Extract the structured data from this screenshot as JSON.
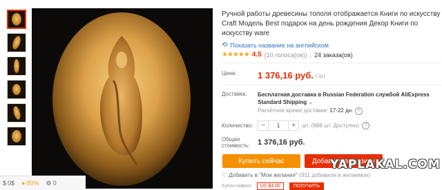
{
  "thumbnails": [
    "thumb-1",
    "thumb-2",
    "thumb-3",
    "thumb-4",
    "thumb-5",
    "thumb-6"
  ],
  "product": {
    "title": "Ручной работы древесины тополя отображается Книги по искусству Craft Модель Best подарок на день рождения Декор Книги по искусству ware",
    "translate_link": "Показать название на английском",
    "rating_value": "4.5",
    "votes": "(10 голоса(ов))",
    "orders": "24 заказа(ов)"
  },
  "price": {
    "label": "Цена:",
    "value": "1 376,16 руб.",
    "unit": "/ шт."
  },
  "shipping": {
    "label": "Доставка:",
    "main": "Бесплатная доставка в Russian Federation службой AliExpress Standard Shipping",
    "time_label": "Расчётное время доставки:",
    "time_value": "17-22 дн."
  },
  "quantity": {
    "label": "Количество:",
    "value": "1",
    "note": "шт. (988 шт. Доступно)",
    "minus": "−",
    "plus": "+"
  },
  "total": {
    "label_line1": "Общая",
    "label_line2": "стоимость:",
    "value": "1 376,16 руб."
  },
  "actions": {
    "buy_now": "Купить сейчас",
    "add_to_cart": "Добавить в корзину",
    "wishlist": "Добавить в \"Мои желания\"",
    "wishlist_count": "(911 добавили в желаемое)"
  },
  "coupon": {
    "label": "Купон нового",
    "badge": "US $4.00",
    "get": "ПОЛУЧИТЬ"
  },
  "watermark": "YAPLAKAL.COM",
  "statusbar": {
    "money": "0$",
    "percent": "80%",
    "count": "0"
  },
  "colors": {
    "accent": "#e62e04",
    "buy": "#f69000",
    "link": "#3477c6",
    "star": "#f5a623"
  }
}
